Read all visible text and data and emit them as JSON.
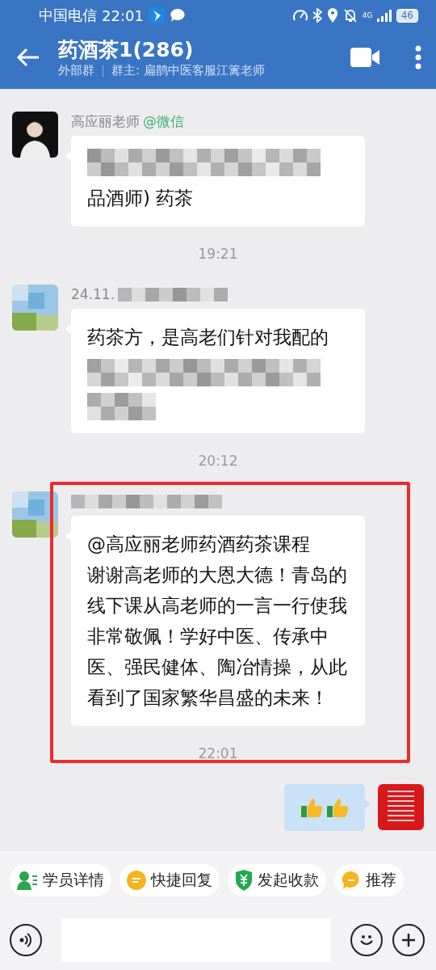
{
  "status_bar": {
    "carrier": "中国电信",
    "time": "22:01",
    "network": "4G",
    "battery": "46"
  },
  "header": {
    "title": "药酒茶1(286)",
    "group_type": "外部群",
    "owner": "群主: 扁鹊中医客服江篱老师"
  },
  "messages": [
    {
      "kind": "incoming",
      "sender": "高应丽老师",
      "sender_tag": "@微信",
      "content": [
        {
          "kind": "blur-line"
        },
        {
          "kind": "text",
          "text": "品酒师) 药茶"
        }
      ],
      "highlighted": false
    },
    {
      "kind": "time",
      "text": "19:21"
    },
    {
      "kind": "incoming",
      "sender": "24.11.",
      "sender_blurred": true,
      "content": [
        {
          "kind": "text",
          "text": "药茶方，是高老们针对我配的"
        },
        {
          "kind": "blur-line"
        },
        {
          "kind": "blur-short"
        }
      ],
      "highlighted": false
    },
    {
      "kind": "time",
      "text": "20:12"
    },
    {
      "kind": "incoming",
      "sender_blurred": true,
      "content": [
        {
          "kind": "text",
          "text": "@高应丽老师药酒药茶课程"
        },
        {
          "kind": "text",
          "text": "谢谢高老师的大恩大德！青岛的线下课从高老师的一言一行使我非常敬佩！学好中医、传承中医、强民健体、陶冶情操，从此看到了国家繁华昌盛的未来！"
        }
      ],
      "highlighted": true
    },
    {
      "kind": "time",
      "text": "22:01"
    },
    {
      "kind": "outgoing",
      "content": [
        {
          "kind": "thumbs"
        },
        {
          "kind": "thumbs"
        }
      ],
      "highlighted": false
    }
  ],
  "quick_actions": [
    {
      "label": "学员详情"
    },
    {
      "label": "快捷回复"
    },
    {
      "label": "发起收款"
    },
    {
      "label": "推荐"
    }
  ]
}
